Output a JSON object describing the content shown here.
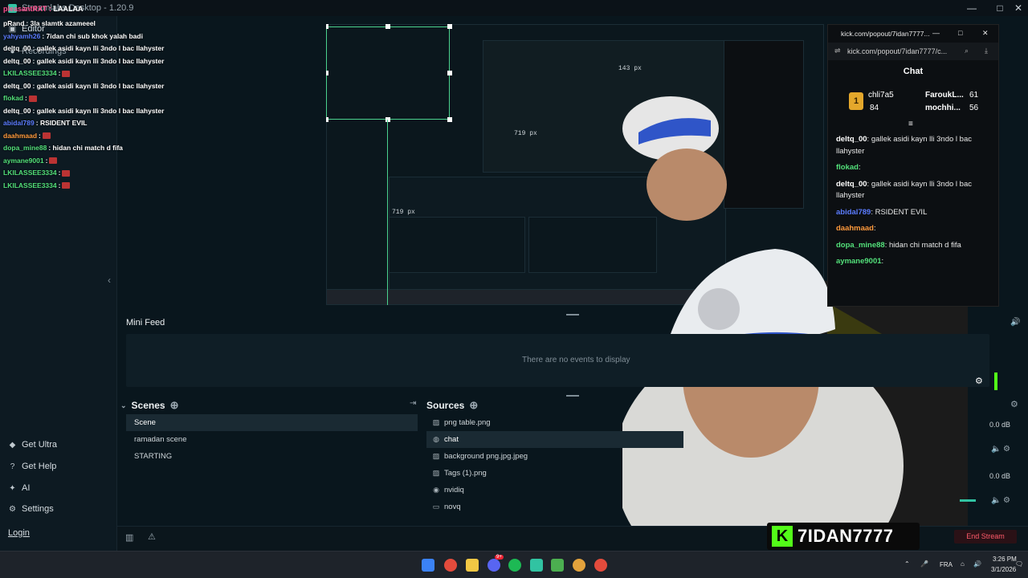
{
  "window": {
    "title": "Streamlabs Desktop - 1.20.9",
    "min": "—",
    "max": "□",
    "close": "✕"
  },
  "overlay_header": "LAALAA",
  "chat_overlay": [
    {
      "user": "pRand",
      "msg": ": 3la slamtk azameeel",
      "user_color": "#ffffff"
    },
    {
      "user": "yahyamh26",
      "msg": ": 7idan chi sub khok yalah badi",
      "user_color": "#5b7cff"
    },
    {
      "user": "deltq_00",
      "msg": ": gallek asidi kayn lli 3ndo l bac llahyster",
      "user_color": "#ffffff"
    },
    {
      "user": "deltq_00",
      "msg": ": gallek asidi kayn lli 3ndo l bac llahyster",
      "user_color": "#ffffff"
    },
    {
      "user": "LKILASSEE3334",
      "msg": ":",
      "user_color": "#53e07a",
      "emote": true
    },
    {
      "user": "deltq_00",
      "msg": ": gallek asidi kayn lli 3ndo l bac llahyster",
      "user_color": "#ffffff"
    },
    {
      "user": "flokad",
      "msg": ":",
      "user_color": "#53e07a",
      "emote": true
    },
    {
      "user": "deltq_00",
      "msg": ": gallek asidi kayn lli 3ndo l bac llahyster",
      "user_color": "#ffffff"
    },
    {
      "user": "abidal789",
      "msg": ": RSIDENT EVIL",
      "user_color": "#5b7cff"
    },
    {
      "user": "daahmaad",
      "msg": ":",
      "user_color": "#ff9a3c",
      "emote": true
    },
    {
      "user": "dopa_mine88",
      "msg": ": hidan chi match d fifa",
      "user_color": "#53e07a"
    },
    {
      "user": "aymane9001",
      "msg": ":",
      "user_color": "#53e07a",
      "emote": true
    },
    {
      "user": "LKILASSEE3334",
      "msg": ":",
      "user_color": "#53e07a",
      "emote": true
    },
    {
      "user": "LKILASSEE3334",
      "msg": ":",
      "user_color": "#53e07a",
      "emote": true
    }
  ],
  "nav": {
    "editor": "Editor",
    "recordings": "Recordings",
    "get_ultra": "Get Ultra",
    "get_help": "Get Help",
    "ai": "AI",
    "settings": "Settings",
    "login": "Login"
  },
  "preview": {
    "size_label_1": "719 px",
    "size_label_2": "719 px",
    "size_label_3": "143 px"
  },
  "mini_feed": {
    "title": "Mini Feed",
    "empty": "There are no events to display"
  },
  "scenes": {
    "title": "Scenes",
    "items": [
      {
        "label": "Scene",
        "active": true
      },
      {
        "label": "ramadan scene",
        "active": false
      },
      {
        "label": "STARTING",
        "active": false
      }
    ]
  },
  "sources": {
    "title": "Sources",
    "items": [
      {
        "label": "png table.png",
        "icon": "image-icon",
        "active": false
      },
      {
        "label": "chat",
        "icon": "globe-icon",
        "active": true
      },
      {
        "label": "background png.jpg.jpeg",
        "icon": "image-icon",
        "active": false
      },
      {
        "label": "Tags (1).png",
        "icon": "image-icon",
        "active": false
      },
      {
        "label": "nvidiq",
        "icon": "webcam-icon",
        "active": false
      },
      {
        "label": "novq",
        "icon": "display-icon",
        "active": false
      }
    ]
  },
  "mixer": {
    "db1": "0.0 dB",
    "db2": "0.0 dB"
  },
  "popout": {
    "tab_title": "kick.com/popout/7idan7777...",
    "url": "kick.com/popout/7idan7777/c...",
    "chat_title": "Chat",
    "leaderboard": [
      {
        "rank": "1",
        "name": "chli7a5",
        "count": "84"
      },
      {
        "name": "FaroukL...",
        "count": "61"
      },
      {
        "name": "mochhi...",
        "count": "56"
      }
    ],
    "messages": [
      {
        "user": "deltq_00",
        "msg": ": gallek asidi kayn lli 3ndo l bac",
        "cont": "llahyster",
        "color": "#ffffff"
      },
      {
        "user": "flokad",
        "msg": ":",
        "cont": "",
        "color": "#53e07a"
      },
      {
        "user": "deltq_00",
        "msg": ": gallek asidi kayn lli 3ndo l bac",
        "cont": "llahyster",
        "color": "#ffffff"
      },
      {
        "user": "abidal789",
        "msg": ": RSIDENT EVIL",
        "cont": "",
        "color": "#5b7cff"
      },
      {
        "user": "daahmaad",
        "msg": ":",
        "cont": "",
        "color": "#ff9a3c"
      },
      {
        "user": "dopa_mine88",
        "msg": ": hidan chi match d fifa",
        "cont": "",
        "color": "#53e07a"
      },
      {
        "user": "aymane9001",
        "msg": ":",
        "cont": "",
        "color": "#53e07a"
      }
    ]
  },
  "end_stream": "End Stream",
  "brand": {
    "name": "7IDAN7777"
  },
  "taskbar": {
    "lang": "FRA",
    "time": "3:26 PM",
    "date": "3/1/2026",
    "badge": "9+"
  },
  "colors": {
    "accent": "#31c3a2",
    "kick_green": "#53fc18",
    "end_stream": "#ff5a6a"
  }
}
